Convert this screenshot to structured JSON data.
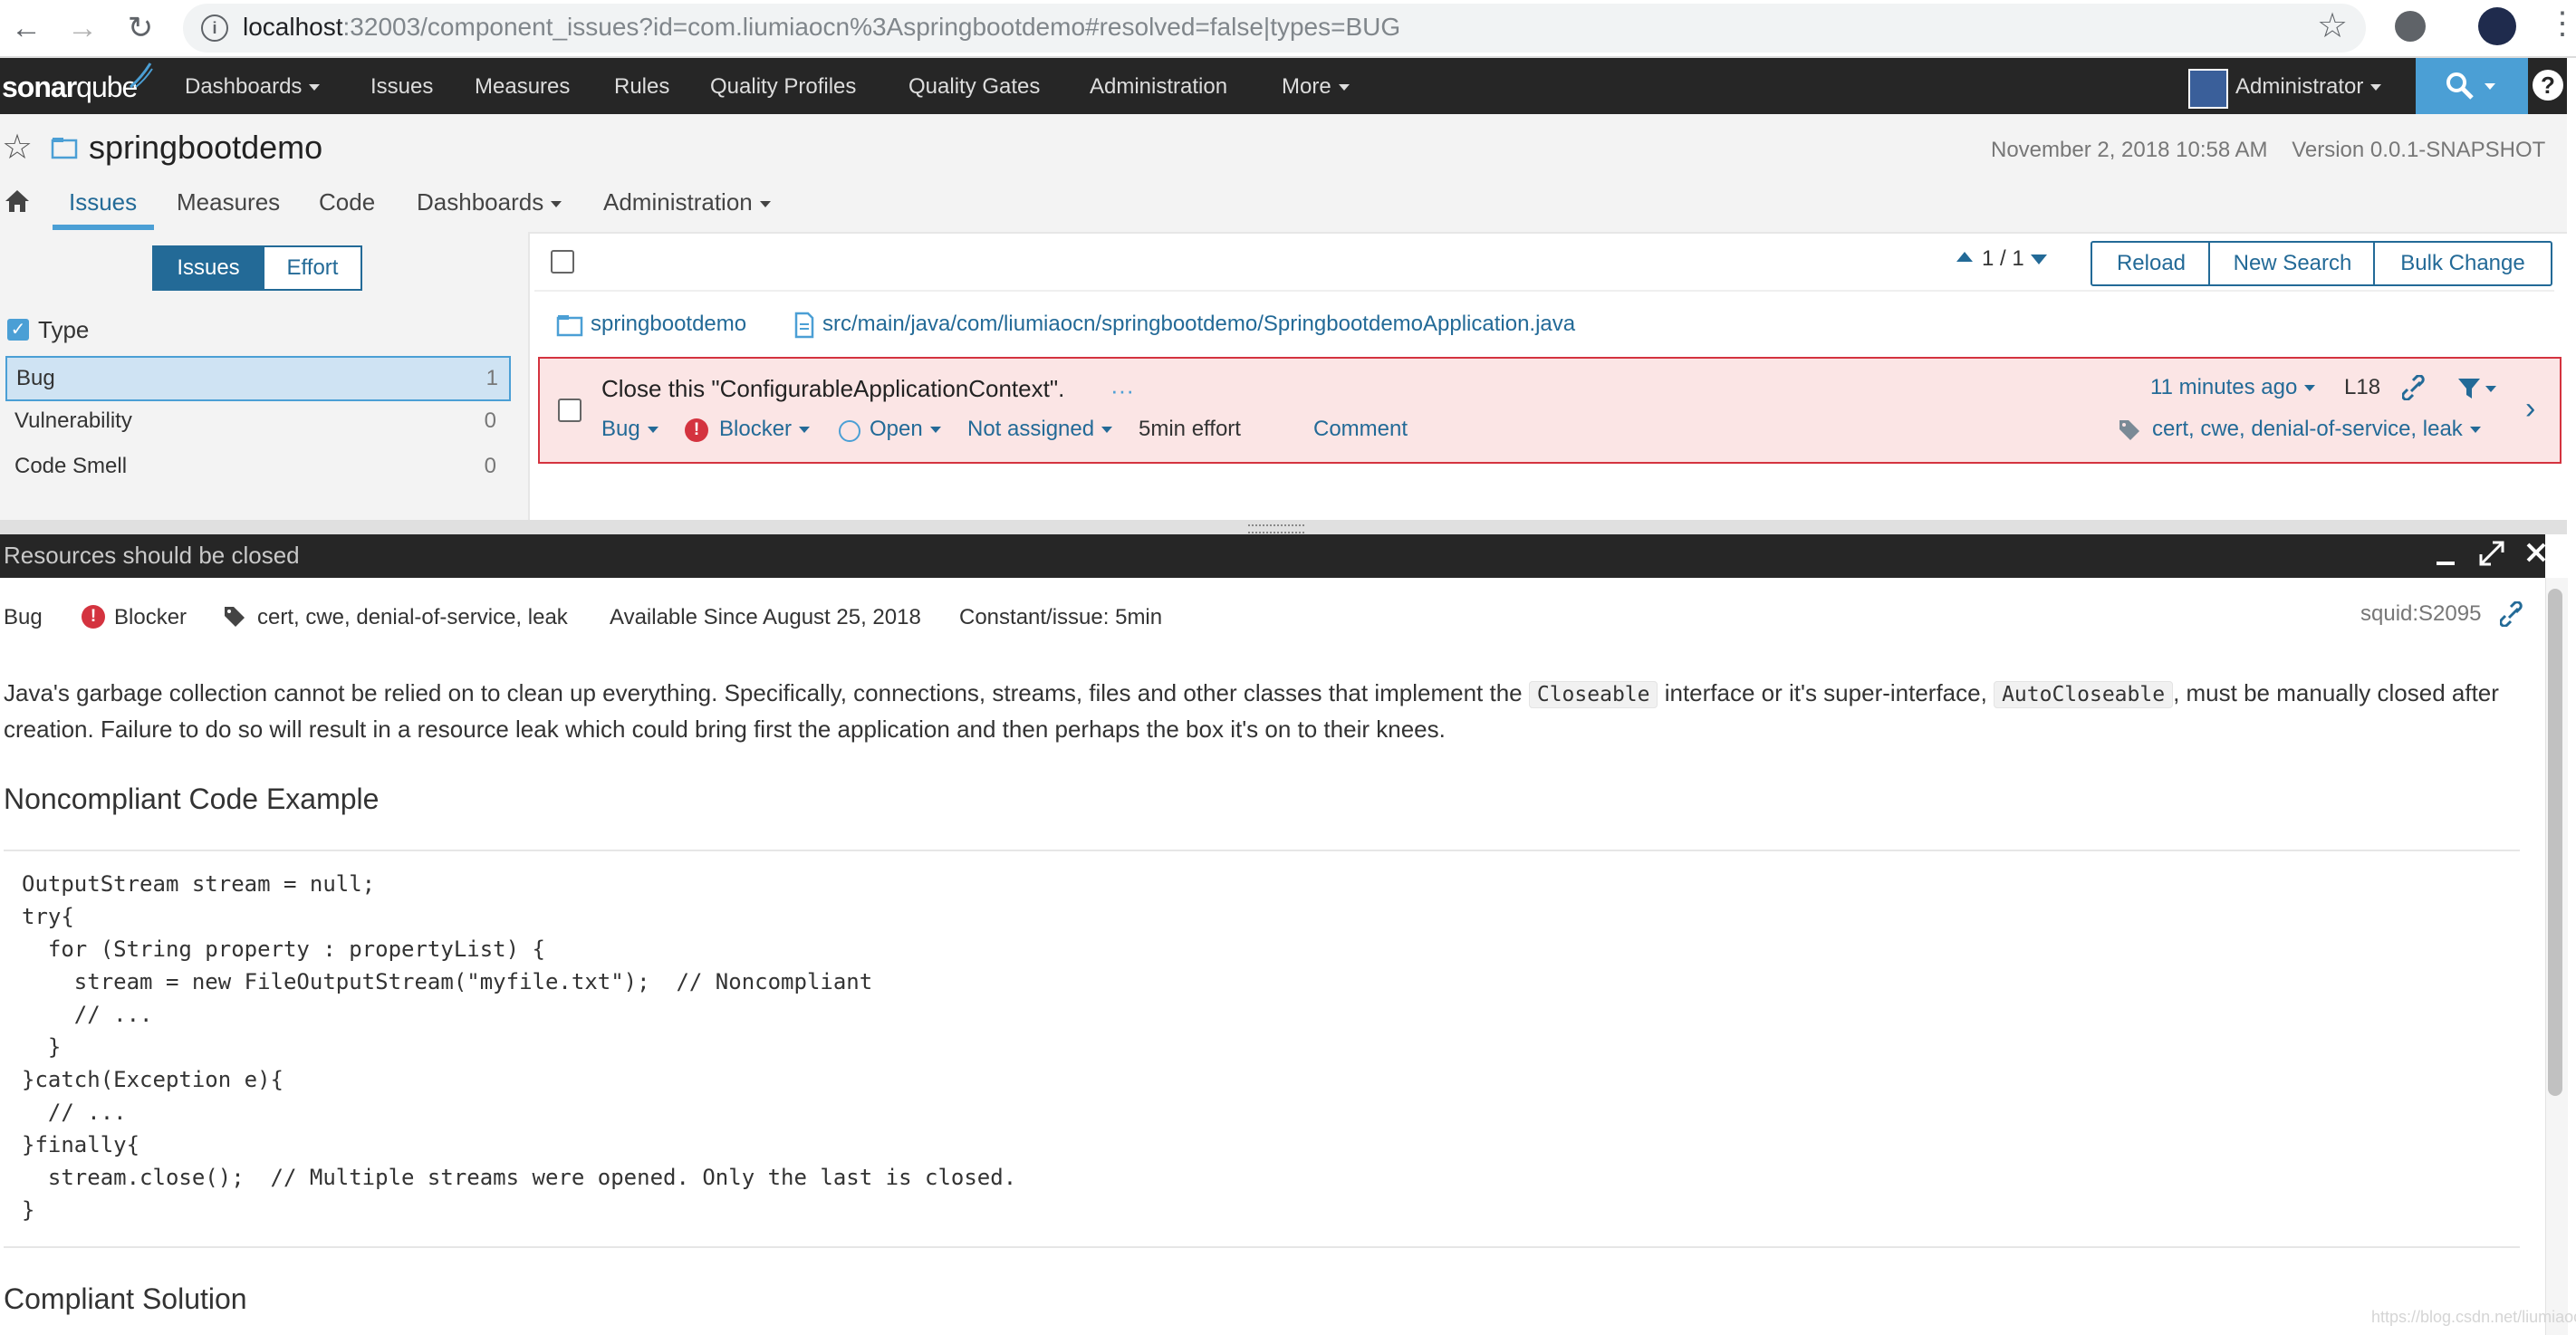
{
  "browser": {
    "url_host": "localhost",
    "url_rest": ":32003/component_issues?id=com.liumiaocn%3Aspringbootdemo#resolved=false|types=BUG"
  },
  "topnav": {
    "logo_a": "sonar",
    "logo_b": "qube",
    "items": [
      "Dashboards",
      "Issues",
      "Measures",
      "Rules",
      "Quality Profiles",
      "Quality Gates",
      "Administration",
      "More"
    ],
    "user": "Administrator"
  },
  "component": {
    "name": "springbootdemo",
    "date": "November 2, 2018 10:58 AM",
    "version": "Version 0.0.1-SNAPSHOT",
    "tabs": [
      "Issues",
      "Measures",
      "Code",
      "Dashboards",
      "Administration"
    ]
  },
  "sidebar": {
    "mode_issues": "Issues",
    "mode_effort": "Effort",
    "facet_title": "Type",
    "facets": [
      {
        "name": "Bug",
        "count": "1"
      },
      {
        "name": "Vulnerability",
        "count": "0"
      },
      {
        "name": "Code Smell",
        "count": "0"
      }
    ]
  },
  "issues_toolbar": {
    "paging": "1 / 1",
    "reload": "Reload",
    "new_search": "New Search",
    "bulk_change": "Bulk Change"
  },
  "breadcrumb": {
    "project": "springbootdemo",
    "file": "src/main/java/com/liumiaocn/springbootdemo/SpringbootdemoApplication.java"
  },
  "issue": {
    "message": "Close this \"ConfigurableApplicationContext\".",
    "age": "11 minutes ago",
    "line": "L18",
    "type": "Bug",
    "severity": "Blocker",
    "status": "Open",
    "assignee": "Not assigned",
    "effort": "5min effort",
    "comment": "Comment",
    "tags": "cert, cwe, denial-of-service, leak"
  },
  "rule": {
    "title": "Resources should be closed",
    "type": "Bug",
    "severity": "Blocker",
    "tags": "cert, cwe, denial-of-service, leak",
    "available_since": "Available Since August 25, 2018",
    "remediation": "Constant/issue: 5min",
    "key": "squid:S2095",
    "desc_part1": "Java's garbage collection cannot be relied on to clean up everything. Specifically, connections, streams, files and other classes that implement the ",
    "desc_code1": "Closeable",
    "desc_part2": " interface or it's super-interface, ",
    "desc_code2": "AutoCloseable",
    "desc_part3": ", must be manually closed after creation. Failure to do so will result in a resource leak which could bring first the application and then perhaps the box it's on to their knees.",
    "noncompliant_heading": "Noncompliant Code Example",
    "noncompliant_code": "OutputStream stream = null;\ntry{\n  for (String property : propertyList) {\n    stream = new FileOutputStream(\"myfile.txt\");  // Noncompliant\n    // ...\n  }\n}catch(Exception e){\n  // ...\n}finally{\n  stream.close();  // Multiple streams were opened. Only the last is closed.\n}",
    "compliant_heading": "Compliant Solution"
  },
  "watermark": "https://blog.csdn.net/liumiaocn",
  "colors": {
    "accent": "#236a97",
    "nav_bg": "#262626",
    "search_blue": "#4b9fd5",
    "blocker_red": "#d4333f",
    "issue_bg": "#fbe5e5"
  }
}
